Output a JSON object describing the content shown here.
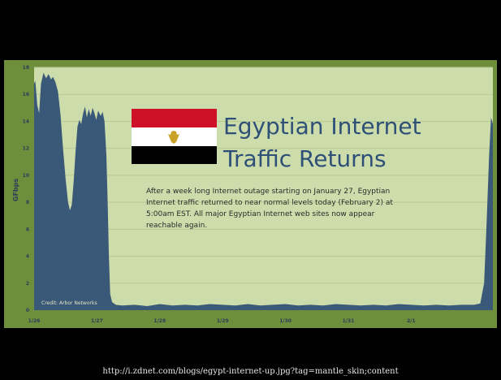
{
  "caption": "http://i.zdnet.com/blogs/egypt-internet-up.jpg?tag=mantle_skin;content",
  "headline": {
    "line1": "Egyptian Internet",
    "line2": "Traffic Returns"
  },
  "body_text": [
    "After a week long Internet outage starting on January 27, Egyptian",
    "Internet traffic returned to near normal levels today (February 2)  at",
    "5:00am EST. All major Egyptian Internet web sites now appear",
    "reachable again."
  ],
  "credit": "Credit: Arbor Networks",
  "colors": {
    "frame": "#6f8e3c",
    "plot_background": "#cddcab",
    "area_fill": "#3a5878",
    "flag_red": "#ce1126",
    "flag_white": "#ffffff",
    "flag_black": "#000000",
    "eagle": "#c9a227"
  },
  "chart_data": {
    "type": "area",
    "title": "",
    "xlabel": "",
    "ylabel": "GFbps",
    "ylim": [
      0,
      18
    ],
    "yticks": [
      0,
      2,
      4,
      6,
      8,
      10,
      12,
      14,
      16,
      18
    ],
    "xlim": [
      0,
      7.3
    ],
    "xticks": [
      {
        "value": 0,
        "label": "1/26"
      },
      {
        "value": 1,
        "label": "1/27"
      },
      {
        "value": 2,
        "label": "1/28"
      },
      {
        "value": 3,
        "label": "1/29"
      },
      {
        "value": 4,
        "label": "1/30"
      },
      {
        "value": 5,
        "label": "1/31"
      },
      {
        "value": 6,
        "label": "2/1"
      }
    ],
    "grid": true,
    "series": [
      {
        "points": [
          [
            0.0,
            16.8
          ],
          [
            0.02,
            17.0
          ],
          [
            0.05,
            15.2
          ],
          [
            0.08,
            14.6
          ],
          [
            0.11,
            16.8
          ],
          [
            0.15,
            17.6
          ],
          [
            0.19,
            17.2
          ],
          [
            0.23,
            17.5
          ],
          [
            0.27,
            17.1
          ],
          [
            0.3,
            17.3
          ],
          [
            0.34,
            16.9
          ],
          [
            0.38,
            16.2
          ],
          [
            0.42,
            14.5
          ],
          [
            0.46,
            12.0
          ],
          [
            0.5,
            9.8
          ],
          [
            0.54,
            8.0
          ],
          [
            0.57,
            7.4
          ],
          [
            0.6,
            7.8
          ],
          [
            0.63,
            9.6
          ],
          [
            0.66,
            11.8
          ],
          [
            0.69,
            13.6
          ],
          [
            0.72,
            14.1
          ],
          [
            0.75,
            13.8
          ],
          [
            0.78,
            14.6
          ],
          [
            0.81,
            15.1
          ],
          [
            0.84,
            14.3
          ],
          [
            0.87,
            14.9
          ],
          [
            0.9,
            14.4
          ],
          [
            0.93,
            15.0
          ],
          [
            0.96,
            14.6
          ],
          [
            0.99,
            14.1
          ],
          [
            1.02,
            14.8
          ],
          [
            1.06,
            14.4
          ],
          [
            1.09,
            14.7
          ],
          [
            1.12,
            14.0
          ],
          [
            1.15,
            11.5
          ],
          [
            1.17,
            8.0
          ],
          [
            1.19,
            4.0
          ],
          [
            1.21,
            1.2
          ],
          [
            1.24,
            0.6
          ],
          [
            1.3,
            0.4
          ],
          [
            1.4,
            0.35
          ],
          [
            1.6,
            0.4
          ],
          [
            1.8,
            0.3
          ],
          [
            2.0,
            0.45
          ],
          [
            2.2,
            0.35
          ],
          [
            2.4,
            0.4
          ],
          [
            2.6,
            0.35
          ],
          [
            2.8,
            0.45
          ],
          [
            3.0,
            0.4
          ],
          [
            3.2,
            0.35
          ],
          [
            3.4,
            0.45
          ],
          [
            3.6,
            0.35
          ],
          [
            3.8,
            0.4
          ],
          [
            4.0,
            0.45
          ],
          [
            4.2,
            0.35
          ],
          [
            4.4,
            0.4
          ],
          [
            4.6,
            0.35
          ],
          [
            4.8,
            0.45
          ],
          [
            5.0,
            0.4
          ],
          [
            5.2,
            0.35
          ],
          [
            5.4,
            0.4
          ],
          [
            5.6,
            0.35
          ],
          [
            5.8,
            0.45
          ],
          [
            6.0,
            0.4
          ],
          [
            6.2,
            0.35
          ],
          [
            6.4,
            0.4
          ],
          [
            6.6,
            0.35
          ],
          [
            6.8,
            0.4
          ],
          [
            7.0,
            0.4
          ],
          [
            7.1,
            0.5
          ],
          [
            7.16,
            2.0
          ],
          [
            7.2,
            6.5
          ],
          [
            7.24,
            11.5
          ],
          [
            7.27,
            14.3
          ],
          [
            7.3,
            13.8
          ]
        ]
      }
    ]
  }
}
